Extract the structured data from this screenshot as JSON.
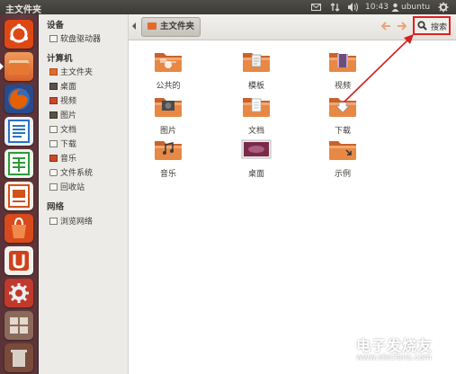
{
  "window_title": "主文件夹",
  "indicators": {
    "time": "10:43",
    "user": "ubuntu"
  },
  "sidebar": {
    "sections": [
      {
        "title": "设备",
        "items": [
          {
            "label": "软盘驱动器",
            "icon": "floppy-icon"
          }
        ]
      },
      {
        "title": "计算机",
        "items": [
          {
            "label": "主文件夹",
            "icon": "home-folder-icon"
          },
          {
            "label": "桌面",
            "icon": "desktop-icon"
          },
          {
            "label": "视频",
            "icon": "video-icon"
          },
          {
            "label": "图片",
            "icon": "picture-icon"
          },
          {
            "label": "文档",
            "icon": "document-icon"
          },
          {
            "label": "下载",
            "icon": "download-icon"
          },
          {
            "label": "音乐",
            "icon": "music-icon"
          },
          {
            "label": "文件系统",
            "icon": "filesystem-icon"
          },
          {
            "label": "回收站",
            "icon": "trash-icon"
          }
        ]
      },
      {
        "title": "网络",
        "items": [
          {
            "label": "浏览网络",
            "icon": "network-icon"
          }
        ]
      }
    ]
  },
  "toolbar": {
    "breadcrumb": "主文件夹",
    "search_label": "搜索",
    "highlight_color": "#e02020"
  },
  "files": [
    {
      "label": "公共的",
      "kind": "public"
    },
    {
      "label": "模板",
      "kind": "templates"
    },
    {
      "label": "视频",
      "kind": "videos"
    },
    {
      "label": "图片",
      "kind": "pictures"
    },
    {
      "label": "文档",
      "kind": "documents"
    },
    {
      "label": "下载",
      "kind": "downloads"
    },
    {
      "label": "音乐",
      "kind": "music"
    },
    {
      "label": "桌面",
      "kind": "desktop"
    },
    {
      "label": "示例",
      "kind": "examples"
    }
  ],
  "launcher": [
    {
      "name": "dash-home-icon",
      "color": "#dd4814"
    },
    {
      "name": "files-icon",
      "color": "#e07030"
    },
    {
      "name": "firefox-icon",
      "color": "#e66000"
    },
    {
      "name": "writer-icon",
      "color": "#2a73c2"
    },
    {
      "name": "calc-icon",
      "color": "#2f9a3a"
    },
    {
      "name": "impress-icon",
      "color": "#d0531a"
    },
    {
      "name": "software-center-icon",
      "color": "#d84a1b"
    },
    {
      "name": "ubuntu-one-icon",
      "color": "#d0421a"
    },
    {
      "name": "system-settings-icon",
      "color": "#c0392b"
    },
    {
      "name": "workspace-switcher-icon",
      "color": "#8a6a5a"
    },
    {
      "name": "trash-launcher-icon",
      "color": "#7a4a3a"
    }
  ],
  "watermark": {
    "brand_text": "电子发烧友",
    "url_text": "www.elecfans.com"
  }
}
